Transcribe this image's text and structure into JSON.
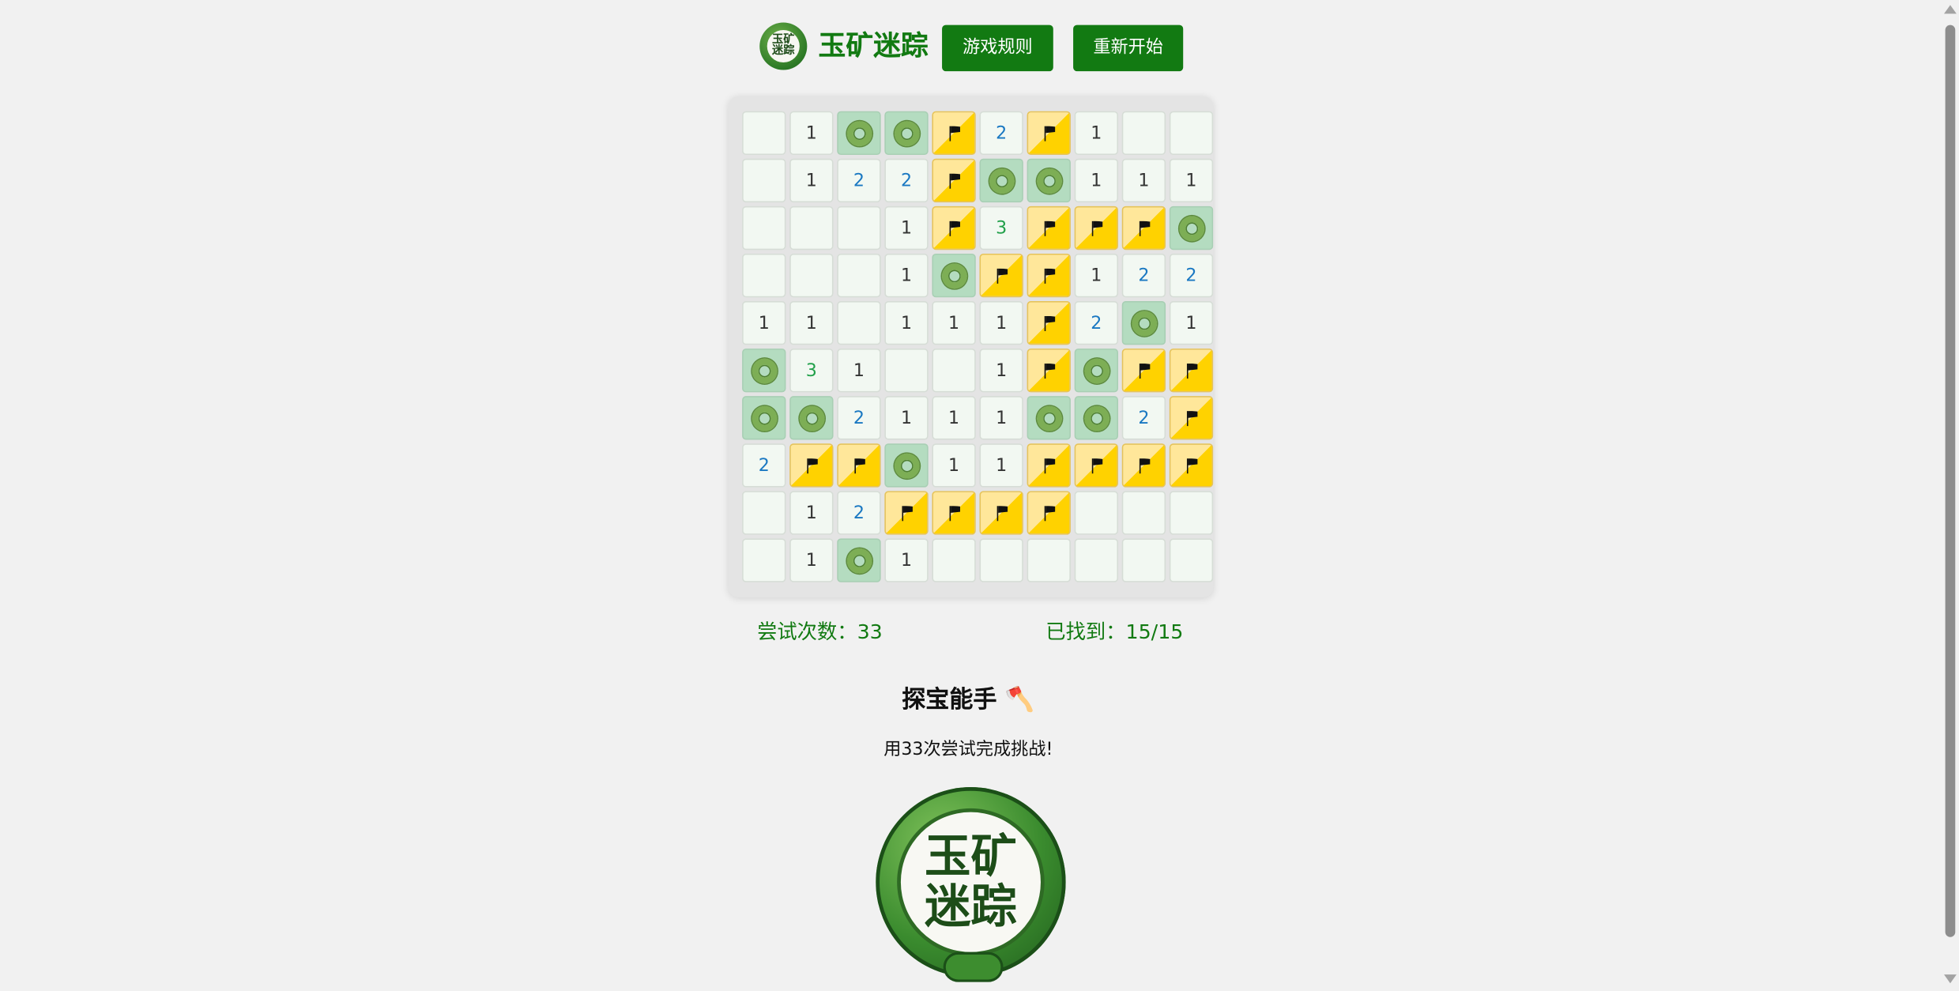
{
  "header": {
    "logo_text": "玉矿迷踪",
    "title": "玉矿迷踪",
    "rules_button": "游戏规则",
    "restart_button": "重新开始"
  },
  "board": {
    "rows": [
      [
        "",
        "1",
        "jade",
        "jade",
        "flag",
        "2",
        "flag",
        "1",
        "",
        ""
      ],
      [
        "",
        "1",
        "2",
        "2",
        "flag",
        "jade",
        "jade",
        "1",
        "1",
        "1"
      ],
      [
        "",
        "",
        "",
        "1",
        "flag",
        "3",
        "flag",
        "flag",
        "flag",
        "jade"
      ],
      [
        "",
        "",
        "",
        "1",
        "jade",
        "flag",
        "flag",
        "1",
        "2",
        "2"
      ],
      [
        "1",
        "1",
        "",
        "1",
        "1",
        "1",
        "flag",
        "2",
        "jade",
        "1"
      ],
      [
        "jade",
        "3",
        "1",
        "",
        "",
        "1",
        "flag",
        "jade",
        "flag",
        "flag"
      ],
      [
        "jade",
        "jade",
        "2",
        "1",
        "1",
        "1",
        "jade",
        "jade",
        "2",
        "flag"
      ],
      [
        "2",
        "flag",
        "flag",
        "jade",
        "1",
        "1",
        "flag",
        "flag",
        "flag",
        "flag"
      ],
      [
        "",
        "1",
        "2",
        "flag",
        "flag",
        "flag",
        "flag",
        "",
        "",
        ""
      ],
      [
        "",
        "1",
        "jade",
        "1",
        "",
        "",
        "",
        "",
        "",
        ""
      ]
    ],
    "icons": {
      "jade": "jade-ring-icon",
      "flag": "flag-icon"
    }
  },
  "stats": {
    "attempts": "尝试次数：33",
    "found": "已找到：15/15"
  },
  "result": {
    "title": "探宝能手 🪓",
    "message": "用33次尝试完成挑战!"
  },
  "big_logo_text": "玉矿迷踪",
  "colors": {
    "accent": "#127a12",
    "flag_light": "#ffe79a",
    "flag_dark": "#ffd200",
    "jade_bg": "#b4dcc0",
    "cell_bg": "#f2f8f2"
  }
}
